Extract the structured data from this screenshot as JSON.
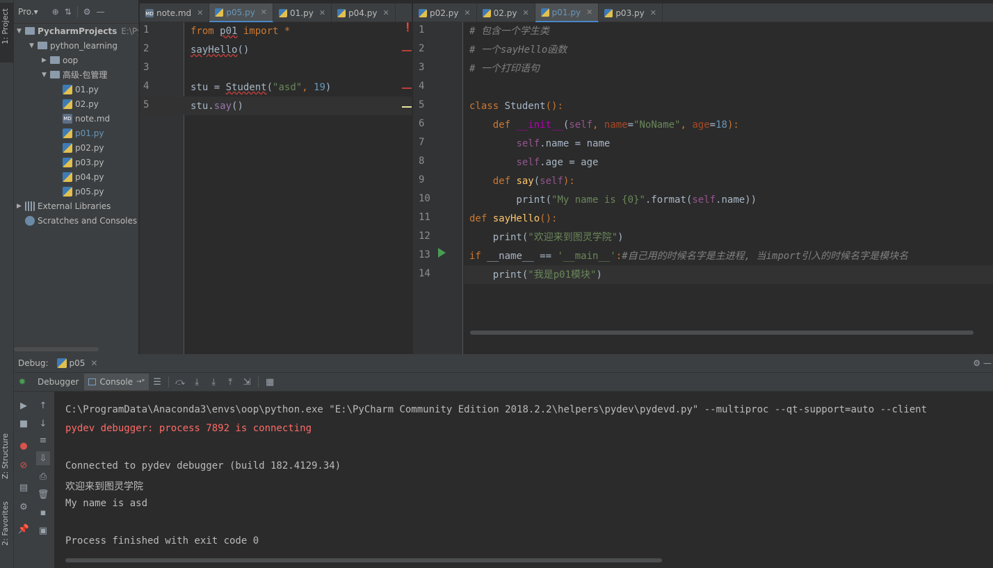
{
  "side_strip": {
    "project_label": "1: Project",
    "structure_label": "Z: Structure",
    "favorites_label": "2: Favorites"
  },
  "project_panel": {
    "title": "Pro.▾",
    "tree": [
      {
        "label": "PycharmProjects",
        "suffix": "E:\\Pyc",
        "icon": "folder-icon",
        "depth": 0,
        "arrow": "▼"
      },
      {
        "label": "python_learning",
        "icon": "folder-icon",
        "depth": 1,
        "arrow": "▼"
      },
      {
        "label": "oop",
        "icon": "folder-icon",
        "depth": 2,
        "arrow": "▶"
      },
      {
        "label": "高级-包管理",
        "icon": "folder-icon",
        "depth": 2,
        "arrow": "▼"
      },
      {
        "label": "01.py",
        "icon": "python-file-icon",
        "depth": 3
      },
      {
        "label": "02.py",
        "icon": "python-file-icon",
        "depth": 3
      },
      {
        "label": "note.md",
        "icon": "markdown-file-icon",
        "depth": 3
      },
      {
        "label": "p01.py",
        "icon": "python-file-icon",
        "depth": 3,
        "highlight": true
      },
      {
        "label": "p02.py",
        "icon": "python-file-icon",
        "depth": 3
      },
      {
        "label": "p03.py",
        "icon": "python-file-icon",
        "depth": 3
      },
      {
        "label": "p04.py",
        "icon": "python-file-icon",
        "depth": 3
      },
      {
        "label": "p05.py",
        "icon": "python-file-icon",
        "depth": 3
      },
      {
        "label": "External Libraries",
        "icon": "libraries-icon",
        "depth": 0,
        "arrow": "▶"
      },
      {
        "label": "Scratches and Consoles",
        "icon": "scratches-icon",
        "depth": 0
      }
    ]
  },
  "left_tabs": [
    {
      "label": "note.md",
      "icon": "markdown-file-icon"
    },
    {
      "label": "p05.py",
      "icon": "python-file-icon",
      "active": true
    },
    {
      "label": "01.py",
      "icon": "python-file-icon"
    },
    {
      "label": "p04.py",
      "icon": "python-file-icon"
    }
  ],
  "right_tabs": [
    {
      "label": "p02.py",
      "icon": "python-file-icon"
    },
    {
      "label": "02.py",
      "icon": "python-file-icon"
    },
    {
      "label": "p01.py",
      "icon": "python-file-icon",
      "active": true
    },
    {
      "label": "p03.py",
      "icon": "python-file-icon"
    }
  ],
  "left_editor": {
    "line_numbers": [
      "1",
      "2",
      "3",
      "4",
      "5"
    ],
    "lines": [
      [
        {
          "t": "from ",
          "c": "kw"
        },
        {
          "t": "p01",
          "c": "warn"
        },
        {
          "t": " import ",
          "c": "kw"
        },
        {
          "t": "*",
          "c": "kw"
        }
      ],
      [
        {
          "t": "sayHello",
          "c": "warn"
        },
        {
          "t": "()",
          "c": ""
        }
      ],
      [],
      [
        {
          "t": "stu = ",
          "c": ""
        },
        {
          "t": "Student",
          "c": "warn"
        },
        {
          "t": "(",
          "c": ""
        },
        {
          "t": "\"asd\"",
          "c": "str"
        },
        {
          "t": ", ",
          "c": "kw"
        },
        {
          "t": "19",
          "c": "num"
        },
        {
          "t": ")",
          "c": ""
        }
      ],
      [
        {
          "t": "stu.",
          "c": ""
        },
        {
          "t": "say",
          "c": "pur"
        },
        {
          "t": "()",
          "c": ""
        }
      ]
    ]
  },
  "right_editor": {
    "line_numbers": [
      "1",
      "2",
      "3",
      "4",
      "5",
      "6",
      "7",
      "8",
      "9",
      "10",
      "11",
      "12",
      "13",
      "14"
    ],
    "lines": [
      [
        {
          "t": "# 包含一个学生类",
          "c": "cm"
        }
      ],
      [
        {
          "t": "# 一个sayHello函数",
          "c": "cm"
        }
      ],
      [
        {
          "t": "# 一个打印语句",
          "c": "cm"
        }
      ],
      [],
      [
        {
          "t": "class ",
          "c": "kw"
        },
        {
          "t": "Student",
          "c": "cls"
        },
        {
          "t": "():",
          "c": "kw"
        }
      ],
      [
        {
          "t": "    def ",
          "c": "kw"
        },
        {
          "t": "__init__",
          "c": "dunder"
        },
        {
          "t": "(",
          "c": ""
        },
        {
          "t": "self",
          "c": "self"
        },
        {
          "t": ", ",
          "c": "kw"
        },
        {
          "t": "name",
          "c": "param"
        },
        {
          "t": "=",
          "c": ""
        },
        {
          "t": "\"NoName\"",
          "c": "str"
        },
        {
          "t": ", ",
          "c": "kw"
        },
        {
          "t": "age",
          "c": "param"
        },
        {
          "t": "=",
          "c": ""
        },
        {
          "t": "18",
          "c": "num"
        },
        {
          "t": "):",
          "c": "kw"
        }
      ],
      [
        {
          "t": "        ",
          "c": ""
        },
        {
          "t": "self",
          "c": "self"
        },
        {
          "t": ".name = name",
          "c": ""
        }
      ],
      [
        {
          "t": "        ",
          "c": ""
        },
        {
          "t": "self",
          "c": "self"
        },
        {
          "t": ".age = age",
          "c": ""
        }
      ],
      [
        {
          "t": "    def ",
          "c": "kw"
        },
        {
          "t": "say",
          "c": "fn"
        },
        {
          "t": "(",
          "c": ""
        },
        {
          "t": "self",
          "c": "self"
        },
        {
          "t": "):",
          "c": "kw"
        }
      ],
      [
        {
          "t": "        print(",
          "c": ""
        },
        {
          "t": "\"My name is {0}\"",
          "c": "str"
        },
        {
          "t": ".format(",
          "c": ""
        },
        {
          "t": "self",
          "c": "self"
        },
        {
          "t": ".name))",
          "c": ""
        }
      ],
      [
        {
          "t": "def ",
          "c": "kw"
        },
        {
          "t": "sayHello",
          "c": "fn"
        },
        {
          "t": "():",
          "c": "kw"
        }
      ],
      [
        {
          "t": "    print(",
          "c": ""
        },
        {
          "t": "\"欢迎来到图灵学院\"",
          "c": "str"
        },
        {
          "t": ")",
          "c": ""
        }
      ],
      [
        {
          "t": "if ",
          "c": "kw"
        },
        {
          "t": "__name__ == ",
          "c": ""
        },
        {
          "t": "'__main__'",
          "c": "str"
        },
        {
          "t": ":",
          "c": "kw"
        },
        {
          "t": "#自己用的时候名字是主进程, 当import引入的时候名字是模块名",
          "c": "cm"
        }
      ],
      [
        {
          "t": "    print(",
          "c": ""
        },
        {
          "t": "\"我是p01模块\"",
          "c": "str"
        },
        {
          "t": ")",
          "c": ""
        }
      ]
    ]
  },
  "debug_panel": {
    "label": "Debug:",
    "session_tab": "p05",
    "debugger_tab": "Debugger",
    "console_tab": "Console",
    "console_tab_suffix": "→*",
    "console_lines": [
      {
        "text": "C:\\ProgramData\\Anaconda3\\envs\\oop\\python.exe \"E:\\PyCharm Community Edition 2018.2.2\\helpers\\pydev\\pydevd.py\" --multiproc --qt-support=auto --client",
        "kind": "normal"
      },
      {
        "text": "pydev debugger: process 7892 is connecting",
        "kind": "err"
      },
      {
        "text": "",
        "kind": "normal"
      },
      {
        "text": "Connected to pydev debugger (build 182.4129.34)",
        "kind": "normal"
      },
      {
        "text": "欢迎来到图灵学院",
        "kind": "normal"
      },
      {
        "text": "My name is asd",
        "kind": "normal"
      },
      {
        "text": "",
        "kind": "normal"
      },
      {
        "text": "Process finished with exit code 0",
        "kind": "normal"
      }
    ]
  },
  "colors": {
    "accent": "#4a88c7",
    "run_green": "#499c54",
    "error_red": "#bc3f3c"
  }
}
